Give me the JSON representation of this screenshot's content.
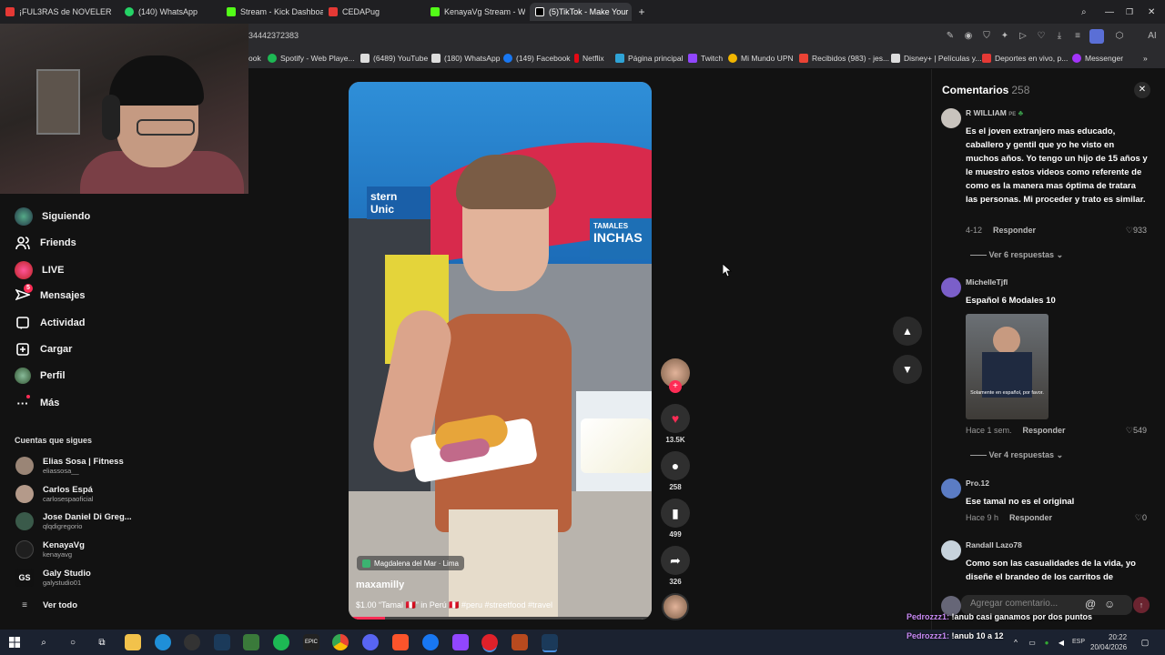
{
  "browser": {
    "tabs": [
      {
        "label": "¡FUL3RAS de NOVELER",
        "color": "#e53935"
      },
      {
        "label": "(140) WhatsApp",
        "color": "#25d366"
      },
      {
        "label": "Stream - Kick Dashboard",
        "color": "#53fc18"
      },
      {
        "label": "CEDAPug",
        "color": "#e53935"
      },
      {
        "label": "KenayaVg Stream - Watch",
        "color": "#53fc18"
      },
      {
        "label": "(5)TikTok - Make Your",
        "color": "#ffffff"
      }
    ],
    "url_fragment": "34442372383",
    "bookmarks": [
      {
        "label": "ook",
        "color": "#1877f2"
      },
      {
        "label": "Spotify - Web Playe...",
        "color": "#1db954"
      },
      {
        "label": "(6489) YouTube",
        "color": "#dddddd"
      },
      {
        "label": "(180) WhatsApp",
        "color": "#25d366"
      },
      {
        "label": "(149) Facebook",
        "color": "#1877f2"
      },
      {
        "label": "Netflix",
        "color": "#e50914"
      },
      {
        "label": "Página principal",
        "color": "#2fa3d6"
      },
      {
        "label": "Twitch",
        "color": "#9146ff"
      },
      {
        "label": "Mi Mundo UPN",
        "color": "#f2b600"
      },
      {
        "label": "Recibidos (983) - jes...",
        "color": "#ea4335"
      },
      {
        "label": "Disney+ | Películas y...",
        "color": "#dddddd"
      },
      {
        "label": "Deportes en vivo, p...",
        "color": "#e53935"
      },
      {
        "label": "Messenger",
        "color": "#a334fa"
      }
    ]
  },
  "sidebar": {
    "nav": [
      {
        "label": "Siguiendo",
        "icon": "following-avatar-icon"
      },
      {
        "label": "Friends",
        "icon": "friends-icon"
      },
      {
        "label": "LIVE",
        "icon": "live-icon"
      },
      {
        "label": "Mensajes",
        "icon": "messages-icon",
        "badge": "5"
      },
      {
        "label": "Actividad",
        "icon": "activity-icon"
      },
      {
        "label": "Cargar",
        "icon": "upload-icon"
      },
      {
        "label": "Perfil",
        "icon": "profile-icon"
      },
      {
        "label": "Más",
        "icon": "more-icon"
      }
    ],
    "following_title": "Cuentas que sigues",
    "following": [
      {
        "name": "Elias Sosa | Fitness",
        "user": "eliassosa__"
      },
      {
        "name": "Carlos Espá",
        "user": "carlosespaoficial"
      },
      {
        "name": "Jose Daniel Di Greg...",
        "user": "qlqdigregorio"
      },
      {
        "name": "KenayaVg",
        "user": "kenayavg"
      },
      {
        "name": "Galy Studio",
        "user": "galystudio01"
      }
    ],
    "see_all": "Ver todo"
  },
  "video": {
    "location": "Magdalena del Mar · Lima",
    "author": "maxamilly",
    "caption": "$1.00 “Tamal 🇵🇪” in Perú 🇵🇪 #peru #streetfood #travel",
    "sign1": "TAMALES",
    "sign2": "INCHAS",
    "progress": 0.12
  },
  "actions": {
    "likes": "13.5K",
    "comments": "258",
    "saves": "499",
    "shares": "326"
  },
  "comments_panel": {
    "title": "Comentarios",
    "count": "258",
    "items": [
      {
        "name": "R WILLIAM",
        "text": "Es el joven extranjero mas educado, caballero y gentil que yo he visto en muchos años. Yo tengo un hijo de 15 años y le muestro estos videos como referente de como es la manera mas óptima de tratara las personas. Mi proceder y trato es similar.",
        "date": "4-12",
        "reply": "Responder",
        "likes": "933",
        "replies": "Ver 6 respuestas"
      },
      {
        "name": "MichelleTjfl",
        "text": "Español 6 Modales 10",
        "date": "Hace 1 sem.",
        "reply": "Responder",
        "likes": "549",
        "replies": "Ver 4 respuestas",
        "image_caption": "Solamente en español, por favor."
      },
      {
        "name": "Pro.12",
        "text": "Ese tamal no es el original",
        "date": "Hace 9 h",
        "reply": "Responder",
        "likes": "0"
      },
      {
        "name": "Randall Lazo78",
        "text": "Como son las casualidades de la vida, yo diseñe el brandeo de los carritos de"
      }
    ],
    "input_placeholder": "Agregar comentario..."
  },
  "chat": [
    {
      "user": "Pedrozzz1:",
      "msg": "!anub casi ganamos por dos puntos"
    },
    {
      "user": "Pedrozzz1:",
      "msg": "!anub 10 a 12"
    }
  ],
  "taskbar": {
    "time": "20:22",
    "date": "20/04/2026",
    "lang": "ESP"
  }
}
